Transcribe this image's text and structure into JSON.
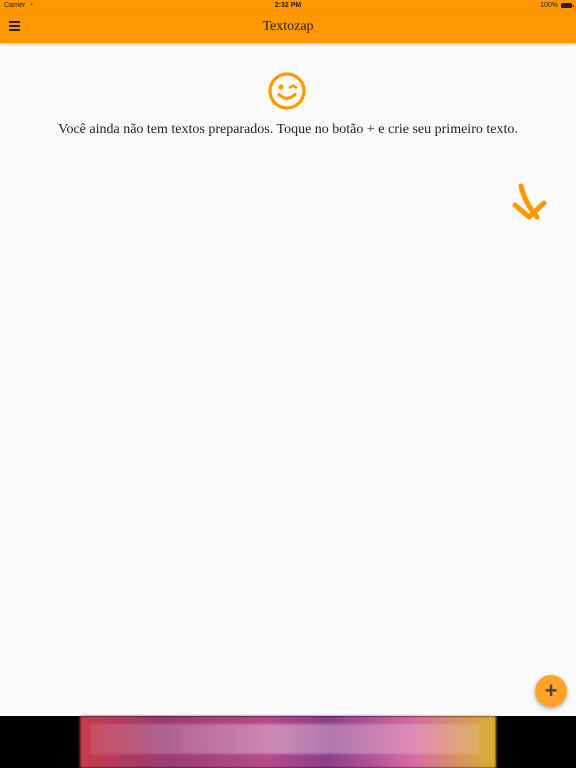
{
  "status_bar": {
    "carrier": "Carrier",
    "time": "2:32 PM",
    "battery": "100%"
  },
  "app_bar": {
    "title": "Textozap",
    "menu_icon": "hamburger-menu-icon"
  },
  "empty_state": {
    "icon": "winking-smiley-icon",
    "message": "Você ainda não tem textos preparados. Toque no botão + e crie seu primeiro texto.",
    "hint_icon": "arrow-down-right-icon"
  },
  "fab": {
    "label": "+",
    "icon": "plus-icon"
  },
  "colors": {
    "accent": "#ff9800",
    "fab": "#ffa226",
    "background": "#fafafa"
  }
}
